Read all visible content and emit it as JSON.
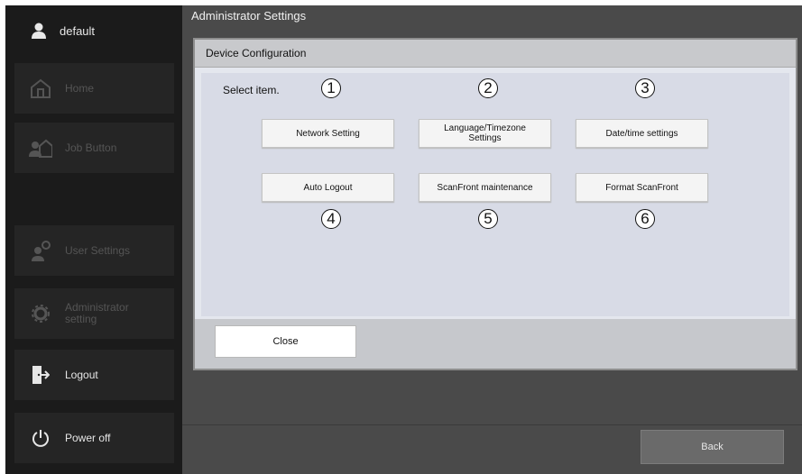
{
  "sidebar": {
    "user": "default",
    "items": [
      {
        "label": "Home",
        "icon": "home-icon"
      },
      {
        "label": "Job Button",
        "icon": "job-button-icon"
      },
      {
        "label": "User Settings",
        "icon": "user-settings-icon"
      },
      {
        "label": "Administrator setting",
        "icon": "gear-icon"
      },
      {
        "label": "Logout",
        "icon": "logout-icon"
      },
      {
        "label": "Power off",
        "icon": "power-icon"
      }
    ]
  },
  "main": {
    "title": "Administrator Settings",
    "back_label": "Back"
  },
  "dialog": {
    "title": "Device Configuration",
    "prompt": "Select item.",
    "options": [
      {
        "label": "Network Setting",
        "number": "1"
      },
      {
        "label": "Language/Timezone Settings",
        "number": "2"
      },
      {
        "label": "Date/time settings",
        "number": "3"
      },
      {
        "label": "Auto Logout",
        "number": "4"
      },
      {
        "label": "ScanFront maintenance",
        "number": "5"
      },
      {
        "label": "Format ScanFront",
        "number": "6"
      }
    ],
    "close_label": "Close"
  },
  "colors": {
    "sidebar_bg": "#1b1b1b",
    "main_bg": "#4a4a4a",
    "dialog_bg": "#e4e7ee",
    "content_bg": "#d8dbe6"
  }
}
